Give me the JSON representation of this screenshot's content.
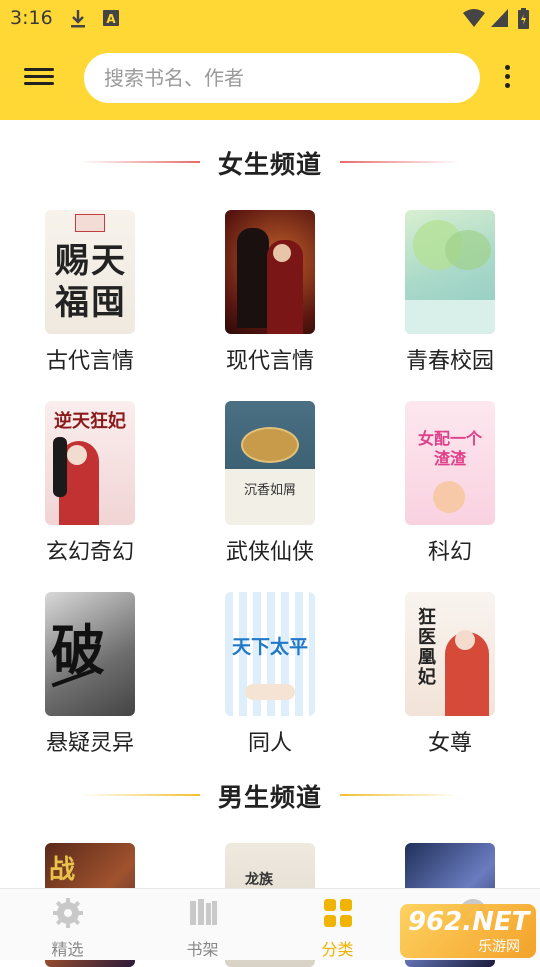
{
  "status_bar": {
    "time": "3:16"
  },
  "header": {
    "search_placeholder": "搜索书名、作者",
    "menu_icon": "hamburger-menu-icon",
    "more_icon": "more-vertical-icon"
  },
  "sections": [
    {
      "title": "女生频道",
      "categories": [
        {
          "label": "古代言情",
          "cover_text": "赐天福囤"
        },
        {
          "label": "现代言情",
          "cover_text": ""
        },
        {
          "label": "青春校园",
          "cover_text": ""
        },
        {
          "label": "玄幻奇幻",
          "cover_text": "逆天狂妃"
        },
        {
          "label": "武侠仙侠",
          "cover_text": "沉香如屑"
        },
        {
          "label": "科幻",
          "cover_text": "女配一个渣渣"
        },
        {
          "label": "悬疑灵异",
          "cover_text": "破"
        },
        {
          "label": "同人",
          "cover_text": "天下太平"
        },
        {
          "label": "女尊",
          "cover_text": "狂医凰妃"
        }
      ]
    },
    {
      "title": "男生频道",
      "categories": [
        {
          "label": "",
          "cover_text": "战"
        },
        {
          "label": "",
          "cover_text": "龙族"
        },
        {
          "label": "",
          "cover_text": ""
        }
      ]
    }
  ],
  "tabbar": {
    "tabs": [
      {
        "label": "精选",
        "icon": "gear-icon",
        "active": false
      },
      {
        "label": "书架",
        "icon": "bookshelf-icon",
        "active": false
      },
      {
        "label": "分类",
        "icon": "grid-icon",
        "active": true
      },
      {
        "label": "",
        "icon": "compass-icon",
        "active": false
      }
    ]
  },
  "watermark": {
    "line1": "962.NET",
    "line2": "乐游网"
  },
  "colors": {
    "header": "#FFD835",
    "active_tab": "#F0B400",
    "girl_line": "#E86A6A",
    "boy_line": "#F2C12E"
  }
}
